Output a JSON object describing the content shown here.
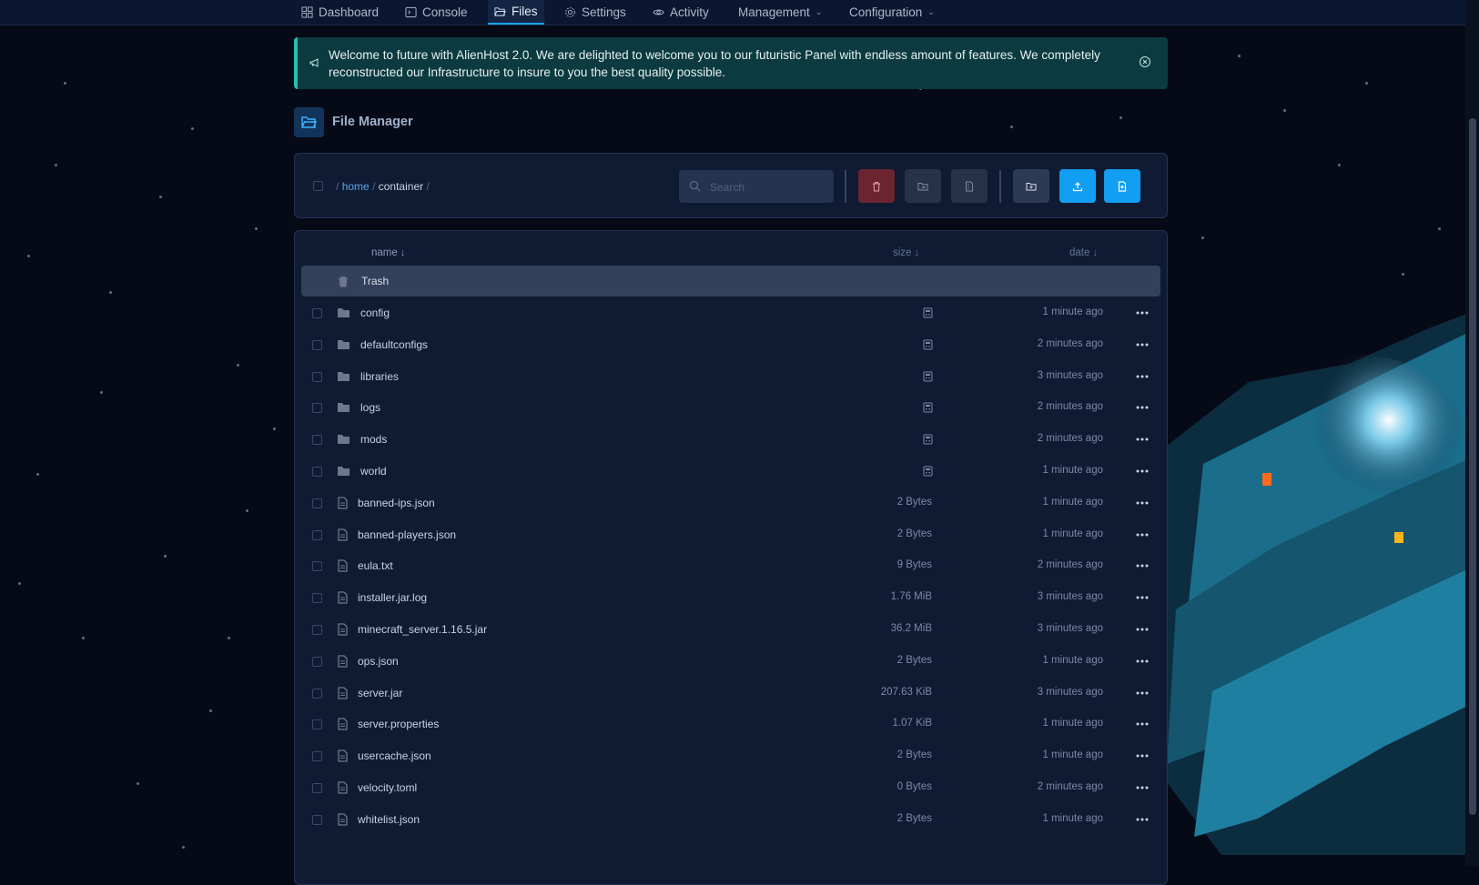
{
  "nav": {
    "items": [
      {
        "label": "Dashboard",
        "icon": "grid-icon"
      },
      {
        "label": "Console",
        "icon": "terminal-icon"
      },
      {
        "label": "Files",
        "icon": "folder-open-icon",
        "active": true
      },
      {
        "label": "Settings",
        "icon": "gear-icon"
      },
      {
        "label": "Activity",
        "icon": "eye-icon"
      },
      {
        "label": "Management",
        "dropdown": true
      },
      {
        "label": "Configuration",
        "dropdown": true
      }
    ]
  },
  "alert": {
    "text": "Welcome to future with AlienHost 2.0. We are delighted to welcome you to our futuristic Panel with endless amount of features. We completely reconstructed our Infrastructure to insure to you the best quality possible.",
    "icon": "megaphone-icon",
    "accent": "#26bfae"
  },
  "file_manager": {
    "title": "File Manager",
    "breadcrumb": {
      "sep": "/",
      "home": "home",
      "current": "container"
    },
    "search": {
      "placeholder": "Search",
      "value": ""
    }
  },
  "table": {
    "headers": {
      "name": "name",
      "size": "size",
      "date": "date",
      "sort_arrow": "↓"
    },
    "trash_label": "Trash",
    "rows": [
      {
        "name": "config",
        "type": "folder",
        "size": "",
        "date": "1 minute ago"
      },
      {
        "name": "defaultconfigs",
        "type": "folder",
        "size": "",
        "date": "2 minutes ago"
      },
      {
        "name": "libraries",
        "type": "folder",
        "size": "",
        "date": "3 minutes ago"
      },
      {
        "name": "logs",
        "type": "folder",
        "size": "",
        "date": "2 minutes ago"
      },
      {
        "name": "mods",
        "type": "folder",
        "size": "",
        "date": "2 minutes ago"
      },
      {
        "name": "world",
        "type": "folder",
        "size": "",
        "date": "1 minute ago"
      },
      {
        "name": "banned-ips.json",
        "type": "file",
        "size": "2 Bytes",
        "date": "1 minute ago"
      },
      {
        "name": "banned-players.json",
        "type": "file",
        "size": "2 Bytes",
        "date": "1 minute ago"
      },
      {
        "name": "eula.txt",
        "type": "file",
        "size": "9 Bytes",
        "date": "2 minutes ago"
      },
      {
        "name": "installer.jar.log",
        "type": "file",
        "size": "1.76 MiB",
        "date": "3 minutes ago"
      },
      {
        "name": "minecraft_server.1.16.5.jar",
        "type": "file",
        "size": "36.2 MiB",
        "date": "3 minutes ago"
      },
      {
        "name": "ops.json",
        "type": "file",
        "size": "2 Bytes",
        "date": "1 minute ago"
      },
      {
        "name": "server.jar",
        "type": "file",
        "size": "207.63 KiB",
        "date": "3 minutes ago"
      },
      {
        "name": "server.properties",
        "type": "file",
        "size": "1.07 KiB",
        "date": "1 minute ago"
      },
      {
        "name": "usercache.json",
        "type": "file",
        "size": "2 Bytes",
        "date": "1 minute ago"
      },
      {
        "name": "velocity.toml",
        "type": "file",
        "size": "0 Bytes",
        "date": "2 minutes ago"
      },
      {
        "name": "whitelist.json",
        "type": "file",
        "size": "2 Bytes",
        "date": "1 minute ago"
      }
    ]
  },
  "colors": {
    "primary": "#129ef2",
    "danger": "#6b2530",
    "panel": "#0f1b33",
    "background": "#060a16"
  }
}
